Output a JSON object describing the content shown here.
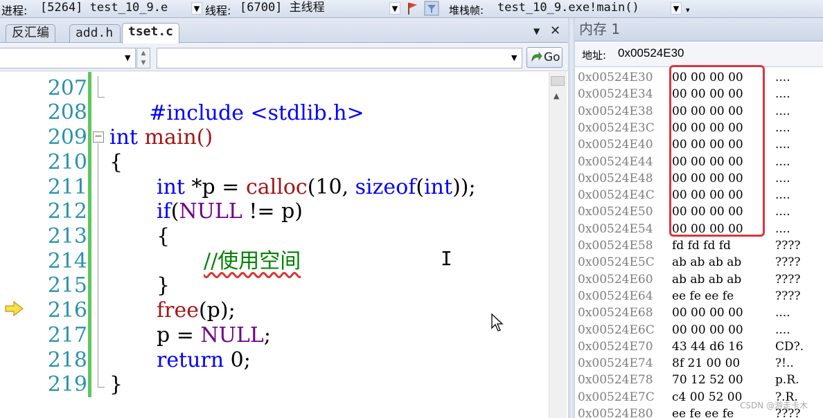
{
  "toolbar": {
    "process_label": "进程:",
    "process_value": "[5264] test_10_9.e",
    "thread_label": "线程:",
    "thread_value": "[6700] 主线程",
    "stack_label": "堆栈帧:",
    "stack_value": "test_10_9.exe!main()"
  },
  "editor": {
    "tabs": [
      {
        "label": "反汇编"
      },
      {
        "label": "add.h"
      },
      {
        "label": "tset.c"
      }
    ],
    "go_label": "Go",
    "lines": [
      {
        "num": "207"
      },
      {
        "num": "208"
      },
      {
        "num": "209"
      },
      {
        "num": "210"
      },
      {
        "num": "211"
      },
      {
        "num": "212"
      },
      {
        "num": "213"
      },
      {
        "num": "214"
      },
      {
        "num": "215"
      },
      {
        "num": "216"
      },
      {
        "num": "217"
      },
      {
        "num": "218"
      },
      {
        "num": "219"
      }
    ],
    "code": {
      "l207_a": "#include <stdlib.h>",
      "l209_kw": "int",
      "l209_fn": " main()",
      "l210": "{",
      "l211_kw": "int",
      "l211_b": " *p = ",
      "l211_fn": "calloc",
      "l211_c": "(10, ",
      "l211_kw2": "sizeof",
      "l211_d": "(",
      "l211_kw3": "int",
      "l211_e": "));",
      "l212_kw": "if",
      "l212_b": "(",
      "l212_mac": "NULL",
      "l212_c": " != p)",
      "l213": "{",
      "l214_cm": "//使用空间",
      "l215": "}",
      "l216_fn": "free",
      "l216_b": "(p);",
      "l217_a": "p = ",
      "l217_mac": "NULL",
      "l217_b": ";",
      "l218_kw": "return",
      "l218_b": " 0;",
      "l219": "}"
    }
  },
  "memory": {
    "title": "内存 1",
    "address_label": "地址:",
    "address_value": "0x00524E30",
    "rows": [
      {
        "addr": "0x00524E30",
        "bytes": "00 00 00 00",
        "ascii": "...."
      },
      {
        "addr": "0x00524E34",
        "bytes": "00 00 00 00",
        "ascii": "...."
      },
      {
        "addr": "0x00524E38",
        "bytes": "00 00 00 00",
        "ascii": "...."
      },
      {
        "addr": "0x00524E3C",
        "bytes": "00 00 00 00",
        "ascii": "...."
      },
      {
        "addr": "0x00524E40",
        "bytes": "00 00 00 00",
        "ascii": "...."
      },
      {
        "addr": "0x00524E44",
        "bytes": "00 00 00 00",
        "ascii": "...."
      },
      {
        "addr": "0x00524E48",
        "bytes": "00 00 00 00",
        "ascii": "...."
      },
      {
        "addr": "0x00524E4C",
        "bytes": "00 00 00 00",
        "ascii": "...."
      },
      {
        "addr": "0x00524E50",
        "bytes": "00 00 00 00",
        "ascii": "...."
      },
      {
        "addr": "0x00524E54",
        "bytes": "00 00 00 00",
        "ascii": "...."
      },
      {
        "addr": "0x00524E58",
        "bytes": "fd fd fd fd",
        "ascii": "????"
      },
      {
        "addr": "0x00524E5C",
        "bytes": "ab ab ab ab",
        "ascii": "????"
      },
      {
        "addr": "0x00524E60",
        "bytes": "ab ab ab ab",
        "ascii": "????"
      },
      {
        "addr": "0x00524E64",
        "bytes": "ee fe ee fe",
        "ascii": "????"
      },
      {
        "addr": "0x00524E68",
        "bytes": "00 00 00 00",
        "ascii": "...."
      },
      {
        "addr": "0x00524E6C",
        "bytes": "00 00 00 00",
        "ascii": "...."
      },
      {
        "addr": "0x00524E70",
        "bytes": "43 44 d6 16",
        "ascii": "CD?."
      },
      {
        "addr": "0x00524E74",
        "bytes": "8f 21 00 00",
        "ascii": "?!.."
      },
      {
        "addr": "0x00524E78",
        "bytes": "70 12 52 00",
        "ascii": "p.R."
      },
      {
        "addr": "0x00524E7C",
        "bytes": "c4 00 52 00",
        "ascii": "?.R."
      },
      {
        "addr": "0x00524E80",
        "bytes": "ee fe ee fe",
        "ascii": "????"
      }
    ],
    "highlight_color": "#d9363e"
  },
  "watermark": "CSDN @游走卡木",
  "colors": {
    "keyword": "#0000ff",
    "function": "#a31515",
    "macro": "#6f008a",
    "comment": "#008000",
    "line_number": "#2b91af"
  }
}
